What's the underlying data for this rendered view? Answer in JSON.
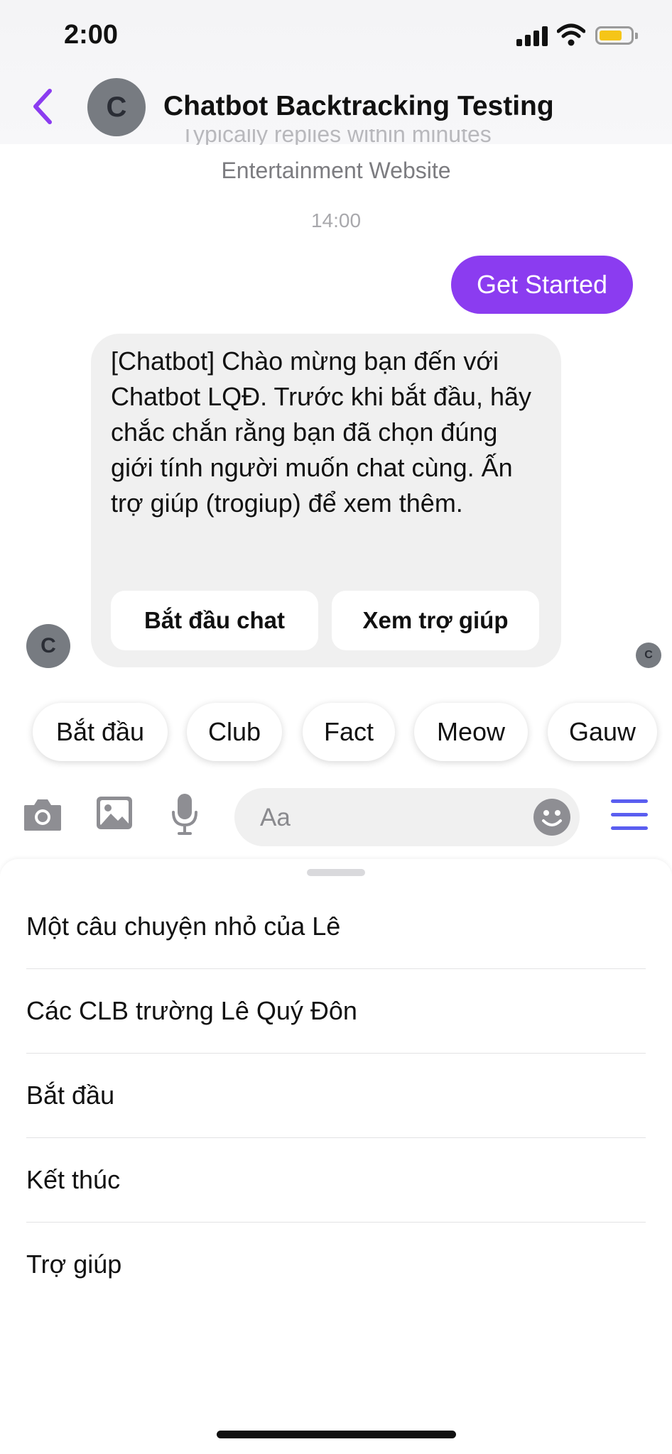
{
  "status_bar": {
    "time": "2:00"
  },
  "header": {
    "avatar_letter": "C",
    "title": "Chatbot Backtracking Testing"
  },
  "profile": {
    "replies_note": "Typically replies within minutes",
    "category": "Entertainment Website"
  },
  "conversation": {
    "timestamp": "14:00",
    "user_message": "Get Started",
    "bot_message": "[Chatbot] Chào mừng bạn đến với Chatbot LQĐ. Trước khi bắt đầu, hãy chắc chắn rằng bạn đã chọn đúng giới tính người muốn chat cùng. Ấn trợ giúp (trogiup) để xem thêm.",
    "bot_buttons": [
      "Bắt đầu chat",
      "Xem trợ giúp"
    ],
    "bot_avatar_letter": "C",
    "read_receipt_letter": "C"
  },
  "quick_replies": [
    "Bắt đầu",
    "Club",
    "Fact",
    "Meow",
    "Gauw"
  ],
  "composer": {
    "placeholder": "Aa",
    "icons": [
      "camera-icon",
      "image-icon",
      "microphone-icon",
      "emoji-icon",
      "menu-icon"
    ],
    "accent_color": "#5a5ef0"
  },
  "persistent_menu": {
    "items": [
      "Một câu chuyện nhỏ của Lê",
      "Các CLB trường Lê Quý Đôn",
      "Bắt đầu",
      "Kết thúc",
      "Trợ giúp"
    ]
  },
  "colors": {
    "brand_purple": "#8b3cf0",
    "back_arrow": "#8b3cf0",
    "battery_fill": "#f5c518"
  }
}
